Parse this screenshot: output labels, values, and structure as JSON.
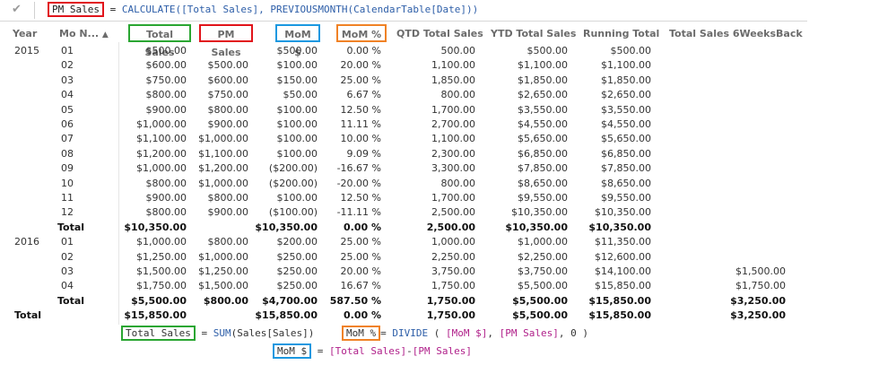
{
  "formula_bar": {
    "name": "PM Sales",
    "eq": " = ",
    "fn": "CALCULATE",
    "args": "([Total Sales], PREVIOUSMONTH(CalendarTable[Date]))"
  },
  "columns": {
    "year": "Year",
    "month": "Mo N...",
    "total_sales": "Total Sales",
    "pm_sales": "PM Sales",
    "mom_dollar": "MoM $",
    "mom_pct": "MoM %",
    "qtd": "QTD Total Sales",
    "ytd": "YTD Total Sales",
    "running": "Running Total",
    "six_weeks": "Total Sales 6WeeksBack"
  },
  "rows": [
    {
      "year": "2015",
      "mo": "01",
      "ts": "$500.00",
      "pm": "",
      "md": "$500.00",
      "mp": "0.00 %",
      "qtd": "500.00",
      "ytd": "$500.00",
      "rt": "$500.00",
      "sw": "",
      "bold": false
    },
    {
      "year": "",
      "mo": "02",
      "ts": "$600.00",
      "pm": "$500.00",
      "md": "$100.00",
      "mp": "20.00 %",
      "qtd": "1,100.00",
      "ytd": "$1,100.00",
      "rt": "$1,100.00",
      "sw": "",
      "bold": false
    },
    {
      "year": "",
      "mo": "03",
      "ts": "$750.00",
      "pm": "$600.00",
      "md": "$150.00",
      "mp": "25.00 %",
      "qtd": "1,850.00",
      "ytd": "$1,850.00",
      "rt": "$1,850.00",
      "sw": "",
      "bold": false
    },
    {
      "year": "",
      "mo": "04",
      "ts": "$800.00",
      "pm": "$750.00",
      "md": "$50.00",
      "mp": "6.67 %",
      "qtd": "800.00",
      "ytd": "$2,650.00",
      "rt": "$2,650.00",
      "sw": "",
      "bold": false
    },
    {
      "year": "",
      "mo": "05",
      "ts": "$900.00",
      "pm": "$800.00",
      "md": "$100.00",
      "mp": "12.50 %",
      "qtd": "1,700.00",
      "ytd": "$3,550.00",
      "rt": "$3,550.00",
      "sw": "",
      "bold": false
    },
    {
      "year": "",
      "mo": "06",
      "ts": "$1,000.00",
      "pm": "$900.00",
      "md": "$100.00",
      "mp": "11.11 %",
      "qtd": "2,700.00",
      "ytd": "$4,550.00",
      "rt": "$4,550.00",
      "sw": "",
      "bold": false
    },
    {
      "year": "",
      "mo": "07",
      "ts": "$1,100.00",
      "pm": "$1,000.00",
      "md": "$100.00",
      "mp": "10.00 %",
      "qtd": "1,100.00",
      "ytd": "$5,650.00",
      "rt": "$5,650.00",
      "sw": "",
      "bold": false
    },
    {
      "year": "",
      "mo": "08",
      "ts": "$1,200.00",
      "pm": "$1,100.00",
      "md": "$100.00",
      "mp": "9.09 %",
      "qtd": "2,300.00",
      "ytd": "$6,850.00",
      "rt": "$6,850.00",
      "sw": "",
      "bold": false
    },
    {
      "year": "",
      "mo": "09",
      "ts": "$1,000.00",
      "pm": "$1,200.00",
      "md": "($200.00)",
      "mp": "-16.67 %",
      "qtd": "3,300.00",
      "ytd": "$7,850.00",
      "rt": "$7,850.00",
      "sw": "",
      "bold": false
    },
    {
      "year": "",
      "mo": "10",
      "ts": "$800.00",
      "pm": "$1,000.00",
      "md": "($200.00)",
      "mp": "-20.00 %",
      "qtd": "800.00",
      "ytd": "$8,650.00",
      "rt": "$8,650.00",
      "sw": "",
      "bold": false
    },
    {
      "year": "",
      "mo": "11",
      "ts": "$900.00",
      "pm": "$800.00",
      "md": "$100.00",
      "mp": "12.50 %",
      "qtd": "1,700.00",
      "ytd": "$9,550.00",
      "rt": "$9,550.00",
      "sw": "",
      "bold": false
    },
    {
      "year": "",
      "mo": "12",
      "ts": "$800.00",
      "pm": "$900.00",
      "md": "($100.00)",
      "mp": "-11.11 %",
      "qtd": "2,500.00",
      "ytd": "$10,350.00",
      "rt": "$10,350.00",
      "sw": "",
      "bold": false
    },
    {
      "year": "",
      "mo": "Total",
      "ts": "$10,350.00",
      "pm": "",
      "md": "$10,350.00",
      "mp": "0.00 %",
      "qtd": "2,500.00",
      "ytd": "$10,350.00",
      "rt": "$10,350.00",
      "sw": "",
      "bold": true,
      "subtotal": true
    },
    {
      "year": "2016",
      "mo": "01",
      "ts": "$1,000.00",
      "pm": "$800.00",
      "md": "$200.00",
      "mp": "25.00 %",
      "qtd": "1,000.00",
      "ytd": "$1,000.00",
      "rt": "$11,350.00",
      "sw": "",
      "bold": false
    },
    {
      "year": "",
      "mo": "02",
      "ts": "$1,250.00",
      "pm": "$1,000.00",
      "md": "$250.00",
      "mp": "25.00 %",
      "qtd": "2,250.00",
      "ytd": "$2,250.00",
      "rt": "$12,600.00",
      "sw": "",
      "bold": false
    },
    {
      "year": "",
      "mo": "03",
      "ts": "$1,500.00",
      "pm": "$1,250.00",
      "md": "$250.00",
      "mp": "20.00 %",
      "qtd": "3,750.00",
      "ytd": "$3,750.00",
      "rt": "$14,100.00",
      "sw": "$1,500.00",
      "bold": false
    },
    {
      "year": "",
      "mo": "04",
      "ts": "$1,750.00",
      "pm": "$1,500.00",
      "md": "$250.00",
      "mp": "16.67 %",
      "qtd": "1,750.00",
      "ytd": "$5,500.00",
      "rt": "$15,850.00",
      "sw": "$1,750.00",
      "bold": false
    },
    {
      "year": "",
      "mo": "Total",
      "ts": "$5,500.00",
      "pm": "$800.00",
      "md": "$4,700.00",
      "mp": "587.50 %",
      "qtd": "1,750.00",
      "ytd": "$5,500.00",
      "rt": "$15,850.00",
      "sw": "$3,250.00",
      "bold": true,
      "subtotal": true
    },
    {
      "year": "Total",
      "mo": "",
      "ts": "$15,850.00",
      "pm": "",
      "md": "$15,850.00",
      "mp": "0.00 %",
      "qtd": "1,750.00",
      "ytd": "$5,500.00",
      "rt": "$15,850.00",
      "sw": "$3,250.00",
      "bold": true
    }
  ],
  "bottom_formulas": {
    "total_sales": {
      "name": "Total Sales",
      "eq": " = ",
      "fn": "SUM",
      "args": "(Sales[Sales])"
    },
    "mom_pct": {
      "name": "MoM %",
      "eq": "= ",
      "fn": "DIVIDE",
      "args1": " ( ",
      "ref1": "[MoM $]",
      "sep": ", ",
      "ref2": "[PM Sales]",
      "args2": ", 0 )"
    },
    "mom_dollar": {
      "name": "MoM $",
      "eq": " = ",
      "ref1": "[Total Sales]",
      "op": "-",
      "ref2": "[PM Sales]"
    }
  },
  "colors": {
    "red": "#e1141b",
    "green": "#2aa632",
    "blue": "#1b98e0",
    "orange": "#f08226"
  }
}
